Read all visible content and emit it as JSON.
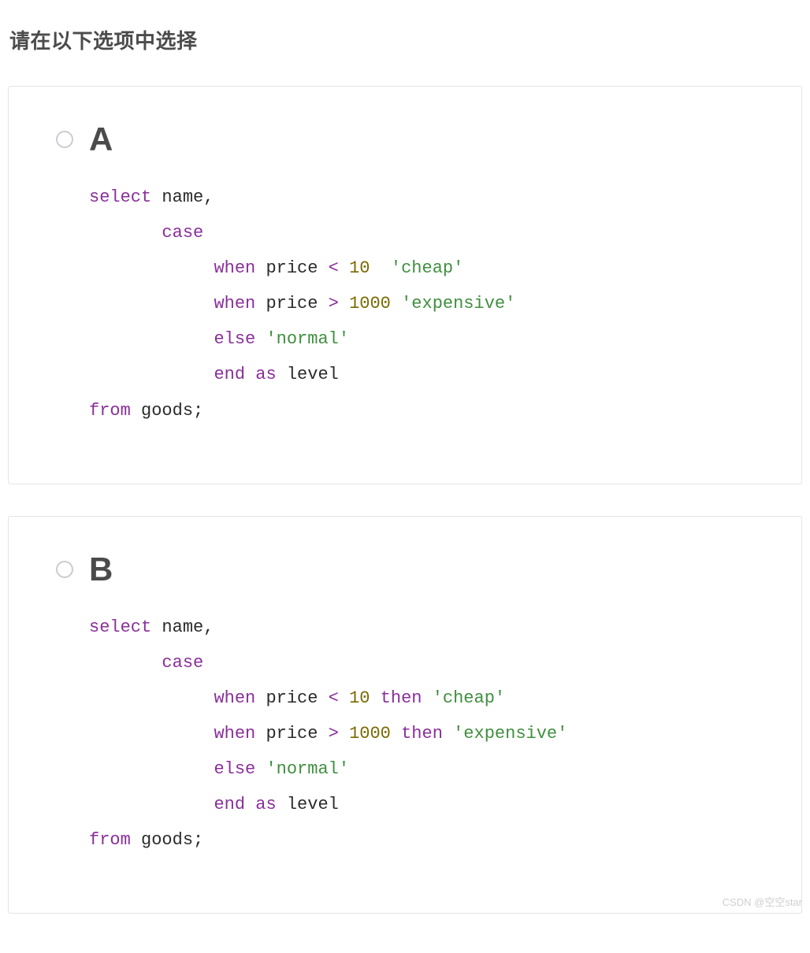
{
  "prompt": "请在以下选项中选择",
  "options": [
    {
      "letter": "A",
      "code": {
        "line1": {
          "kw": "select",
          "t1": " name,"
        },
        "line2": {
          "pad": "       ",
          "kw": "case"
        },
        "line3": {
          "pad": "            ",
          "kw": "when",
          "t1": " price ",
          "op": "<",
          "sp": " ",
          "num": "10",
          "sp2": "  ",
          "str": "'cheap'"
        },
        "line4": {
          "pad": "            ",
          "kw": "when",
          "t1": " price ",
          "op": ">",
          "sp": " ",
          "num": "1000",
          "sp2": " ",
          "str": "'expensive'"
        },
        "line5": {
          "pad": "            ",
          "kw": "else",
          "sp": " ",
          "str": "'normal'"
        },
        "line6": {
          "pad": "            ",
          "kw1": "end",
          "sp1": " ",
          "kw2": "as",
          "t1": " level"
        },
        "line7": {
          "kw": "from",
          "t1": " goods;"
        }
      }
    },
    {
      "letter": "B",
      "code": {
        "line1": {
          "kw": "select",
          "t1": " name,"
        },
        "line2": {
          "pad": "       ",
          "kw": "case"
        },
        "line3": {
          "pad": "            ",
          "kw": "when",
          "t1": " price ",
          "op": "<",
          "sp": " ",
          "num": "10",
          "sp2": " ",
          "kw2": "then",
          "sp3": " ",
          "str": "'cheap'"
        },
        "line4": {
          "pad": "            ",
          "kw": "when",
          "t1": " price ",
          "op": ">",
          "sp": " ",
          "num": "1000",
          "sp2": " ",
          "kw2": "then",
          "sp3": " ",
          "str": "'expensive'"
        },
        "line5": {
          "pad": "            ",
          "kw": "else",
          "sp": " ",
          "str": "'normal'"
        },
        "line6": {
          "pad": "            ",
          "kw1": "end",
          "sp1": " ",
          "kw2": "as",
          "t1": " level"
        },
        "line7": {
          "kw": "from",
          "t1": " goods;"
        }
      }
    }
  ],
  "watermark": "CSDN @空空star"
}
